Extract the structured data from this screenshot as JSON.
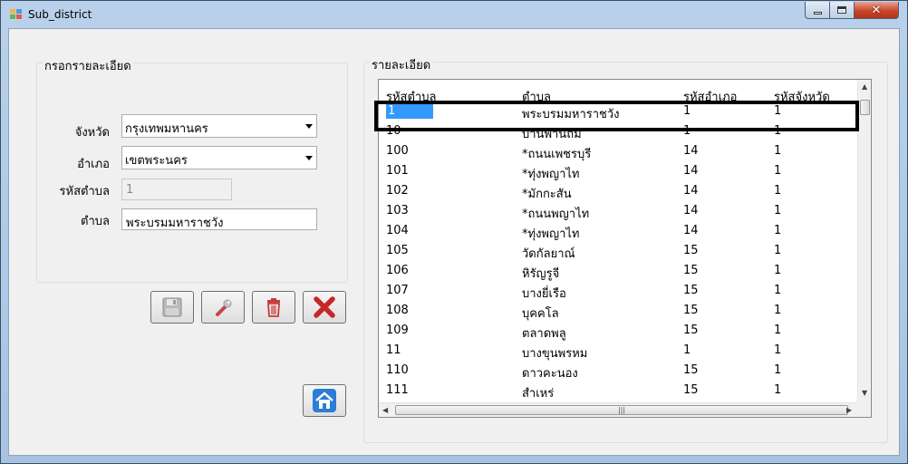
{
  "window": {
    "title": "Sub_district"
  },
  "form": {
    "group_title": "กรอกรายละเอียด",
    "province_label": "จังหวัด",
    "province_value": "กรุงเทพมหานคร",
    "district_label": "อำเภอ",
    "district_value": "เขตพระนคร",
    "subdistrict_code_label": "รหัสตำบล",
    "subdistrict_code_value": "1",
    "subdistrict_label": "ตำบล",
    "subdistrict_value": "พระบรมมหาราชวัง"
  },
  "toolbar": {
    "save_icon": "floppy-disk-icon",
    "edit_icon": "wrench-icon",
    "delete_icon": "trash-icon",
    "cancel_icon": "red-x-icon",
    "home_icon": "home-icon"
  },
  "details": {
    "group_title": "รายละเอียด",
    "columns": [
      "รหัสตำบล",
      "ตำบล",
      "รหัสอำเภอ",
      "รหัสจังหวัด"
    ],
    "rows": [
      [
        "1",
        "พระบรมมหาราชวัง",
        "1",
        "1"
      ],
      [
        "10",
        "บ้านพานถม",
        "1",
        "1"
      ],
      [
        "100",
        "*ถนนเพชรบุรี",
        "14",
        "1"
      ],
      [
        "101",
        "*ทุ่งพญาไท",
        "14",
        "1"
      ],
      [
        "102",
        "*มักกะสัน",
        "14",
        "1"
      ],
      [
        "103",
        "*ถนนพญาไท",
        "14",
        "1"
      ],
      [
        "104",
        "*ทุ่งพญาไท",
        "14",
        "1"
      ],
      [
        "105",
        "วัดกัลยาณ์",
        "15",
        "1"
      ],
      [
        "106",
        "หิรัญรูจี",
        "15",
        "1"
      ],
      [
        "107",
        "บางยี่เรือ",
        "15",
        "1"
      ],
      [
        "108",
        "บุคคโล",
        "15",
        "1"
      ],
      [
        "109",
        "ตลาดพลู",
        "15",
        "1"
      ],
      [
        "11",
        "บางขุนพรหม",
        "1",
        "1"
      ],
      [
        "110",
        "ดาวคะนอง",
        "15",
        "1"
      ],
      [
        "111",
        "สำเหร่",
        "15",
        "1"
      ]
    ],
    "selected_row": 0
  },
  "colors": {
    "selection": "#3399ff",
    "close_button": "#c8452b",
    "title_gradient": "#b9d1ea"
  }
}
